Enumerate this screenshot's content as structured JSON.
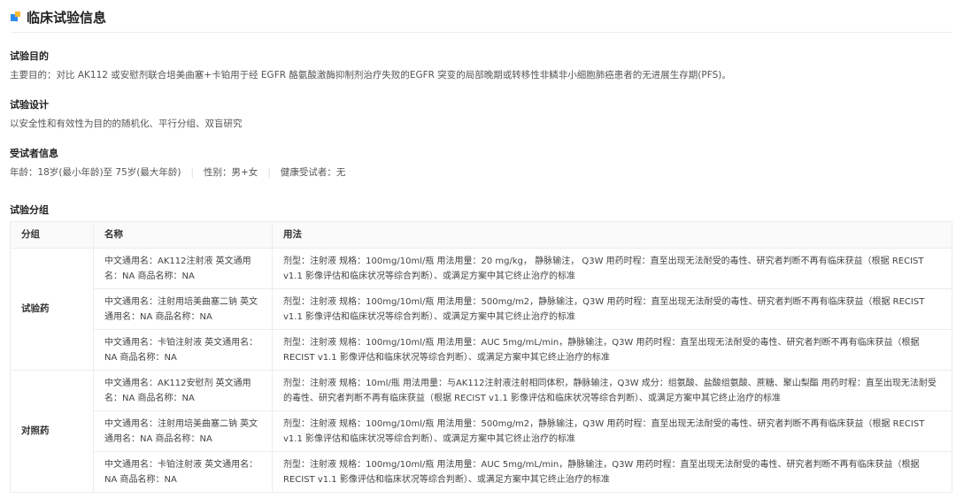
{
  "header": {
    "title": "临床试验信息"
  },
  "objective": {
    "heading": "试验目的",
    "text": "主要目的：对比 AK112 或安慰剂联合培美曲塞+卡铂用于经 EGFR 酪氨酸激酶抑制剂治疗失败的EGFR 突变的局部晚期或转移性非鳞非小细胞肺癌患者的无进展生存期(PFS)。"
  },
  "design": {
    "heading": "试验设计",
    "text": "以安全性和有效性为目的的随机化、平行分组、双盲研究"
  },
  "subjects": {
    "heading": "受试者信息",
    "age": "年龄：18岁(最小年龄)至 75岁(最大年龄)",
    "separator": "|",
    "gender": "性别：男+女",
    "healthy": "健康受试者：无"
  },
  "grouping": {
    "heading": "试验分组",
    "columns": [
      "分组",
      "名称",
      "用法"
    ],
    "groups": [
      {
        "label": "试验药",
        "rows": [
          {
            "name": "中文通用名：AK112注射液 英文通用名：NA 商品名称：NA",
            "usage": "剂型：注射液 规格：100mg/10ml/瓶 用法用量：20 mg/kg， 静脉输注， Q3W 用药时程：直至出现无法耐受的毒性、研究者判断不再有临床获益（根据 RECIST v1.1 影像评估和临床状况等综合判断）、或满足方案中其它终止治疗的标准"
          },
          {
            "name": "中文通用名：注射用培美曲塞二钠 英文通用名：NA 商品名称：NA",
            "usage": "剂型：注射液 规格：100mg/10ml/瓶 用法用量：500mg/m2，静脉输注，Q3W 用药时程：直至出现无法耐受的毒性、研究者判断不再有临床获益（根据 RECIST v1.1 影像评估和临床状况等综合判断）、或满足方案中其它终止治疗的标准"
          },
          {
            "name": "中文通用名：卡铂注射液 英文通用名：NA 商品名称：NA",
            "usage": "剂型：注射液 规格：100mg/10ml/瓶 用法用量：AUC 5mg/mL/min，静脉输注，Q3W 用药时程：直至出现无法耐受的毒性、研究者判断不再有临床获益（根据 RECIST v1.1 影像评估和临床状况等综合判断）、或满足方案中其它终止治疗的标准"
          }
        ]
      },
      {
        "label": "对照药",
        "rows": [
          {
            "name": "中文通用名：AK112安慰剂 英文通用名：NA 商品名称：NA",
            "usage": "剂型：注射液 规格：10ml/瓶 用法用量：与AK112注射液注射相同体积，静脉输注，Q3W 成分：组氨酸、盐酸组氨酸、蔗糖、聚山梨酯 用药时程：直至出现无法耐受的毒性、研究者判断不再有临床获益（根据 RECIST v1.1 影像评估和临床状况等综合判断）、或满足方案中其它终止治疗的标准"
          },
          {
            "name": "中文通用名：注射用培美曲塞二钠 英文通用名：NA 商品名称：NA",
            "usage": "剂型：注射液 规格：100mg/10ml/瓶 用法用量：500mg/m2，静脉输注，Q3W 用药时程：直至出现无法耐受的毒性、研究者判断不再有临床获益（根据 RECIST v1.1 影像评估和临床状况等综合判断）、或满足方案中其它终止治疗的标准"
          },
          {
            "name": "中文通用名：卡铂注射液 英文通用名：NA 商品名称：NA",
            "usage": "剂型：注射液 规格：100mg/10ml/瓶 用法用量：AUC 5mg/mL/min，静脉输注，Q3W 用药时程：直至出现无法耐受的毒性、研究者判断不再有临床获益（根据 RECIST v1.1 影像评估和临床状况等综合判断）、或满足方案中其它终止治疗的标准"
          }
        ]
      }
    ]
  }
}
